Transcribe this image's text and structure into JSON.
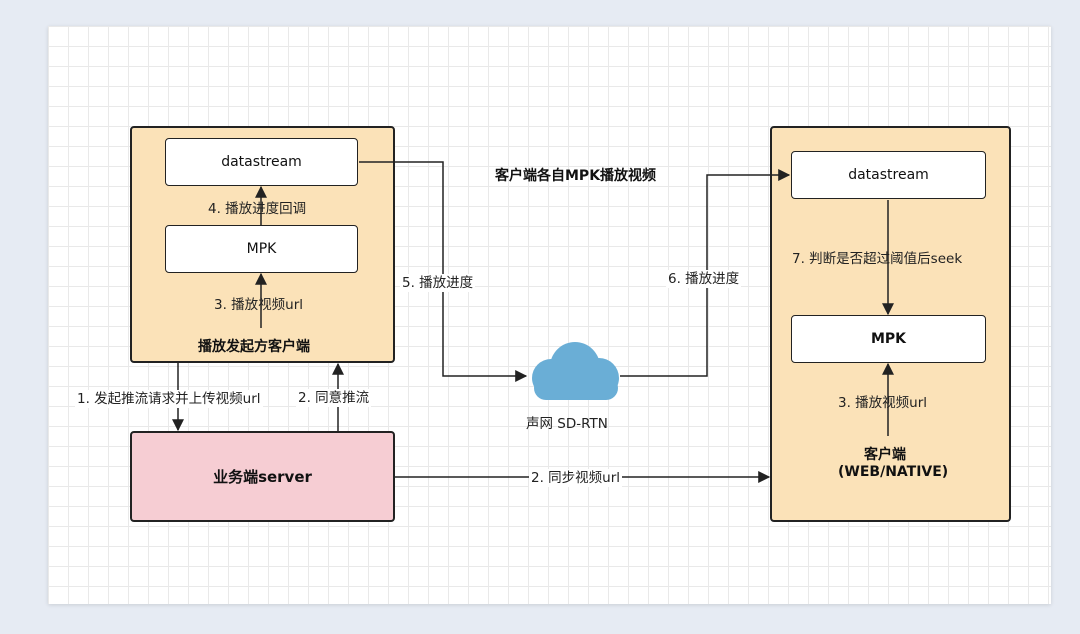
{
  "title": "客户端各自MPK播放视频",
  "left_client": {
    "label": "播放发起方客户端",
    "datastream": "datastream",
    "mpk": "MPK",
    "step4": "4. 播放进度回调",
    "step3": "3. 播放视频url"
  },
  "server": {
    "label": "业务端server"
  },
  "right_client": {
    "label_line1": "客户端",
    "label_line2": "(WEB/NATIVE)",
    "datastream": "datastream",
    "mpk": "MPK",
    "step7": "7. 判断是否超过阈值后seek",
    "step3": "3. 播放视频url"
  },
  "edges": {
    "step1": "1. 发起推流请求并上传视频url",
    "step2_agree": "2. 同意推流",
    "step2_sync": "2. 同步视频url",
    "step5": "5. 播放进度",
    "step6": "6. 播放进度"
  },
  "cloud": {
    "label": "声网 SD-RTN",
    "icon": "cloud-icon"
  },
  "colors": {
    "client_panel": "#fbe2b8",
    "server_panel": "#f6cdd3",
    "cloud": "#6aaed6",
    "border": "#222222"
  }
}
